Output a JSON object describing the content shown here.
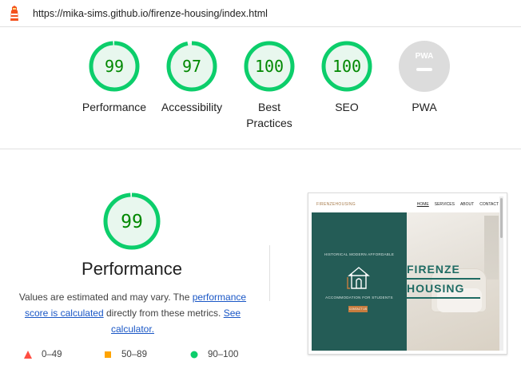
{
  "url": "https://mika-sims.github.io/firenze-housing/index.html",
  "colors": {
    "pass": "#0cce6b",
    "pass_fill": "#e8f7ee",
    "pass_text": "#008800",
    "na": "#dcdcdc",
    "link": "#1a57c6",
    "fail": "#ff4e42",
    "average": "#ffa400"
  },
  "categories": [
    {
      "score": "99",
      "value": 99,
      "label": "Performance"
    },
    {
      "score": "97",
      "value": 97,
      "label": "Accessibility"
    },
    {
      "score": "100",
      "value": 100,
      "label": "Best Practices"
    },
    {
      "score": "100",
      "value": 100,
      "label": "SEO"
    },
    {
      "score": "",
      "value": null,
      "label": "PWA",
      "badge": "PWA"
    }
  ],
  "performance": {
    "score": "99",
    "value": 99,
    "title": "Performance",
    "desc_prefix": "Values are estimated and may vary. The ",
    "desc_link1": "performance score is calculated",
    "desc_middle": " directly from these metrics. ",
    "desc_link2": "See calculator."
  },
  "legend": [
    {
      "range": "0–49",
      "shape": "triangle-icon"
    },
    {
      "range": "50–89",
      "shape": "square-icon"
    },
    {
      "range": "90–100",
      "shape": "circle-icon"
    }
  ],
  "screenshot": {
    "brand": "FIRENZEHOUSING",
    "nav": [
      "HOME",
      "SERVICES",
      "ABOUT",
      "CONTACT"
    ],
    "tagline": "HISTORICAL MODERN AFFORDABLE",
    "subtitle": "ACCOMMODATION FOR STUDENTS",
    "button": "CONTACT US",
    "hero_line1": "FIRENZE",
    "hero_line2": "HOUSING"
  }
}
